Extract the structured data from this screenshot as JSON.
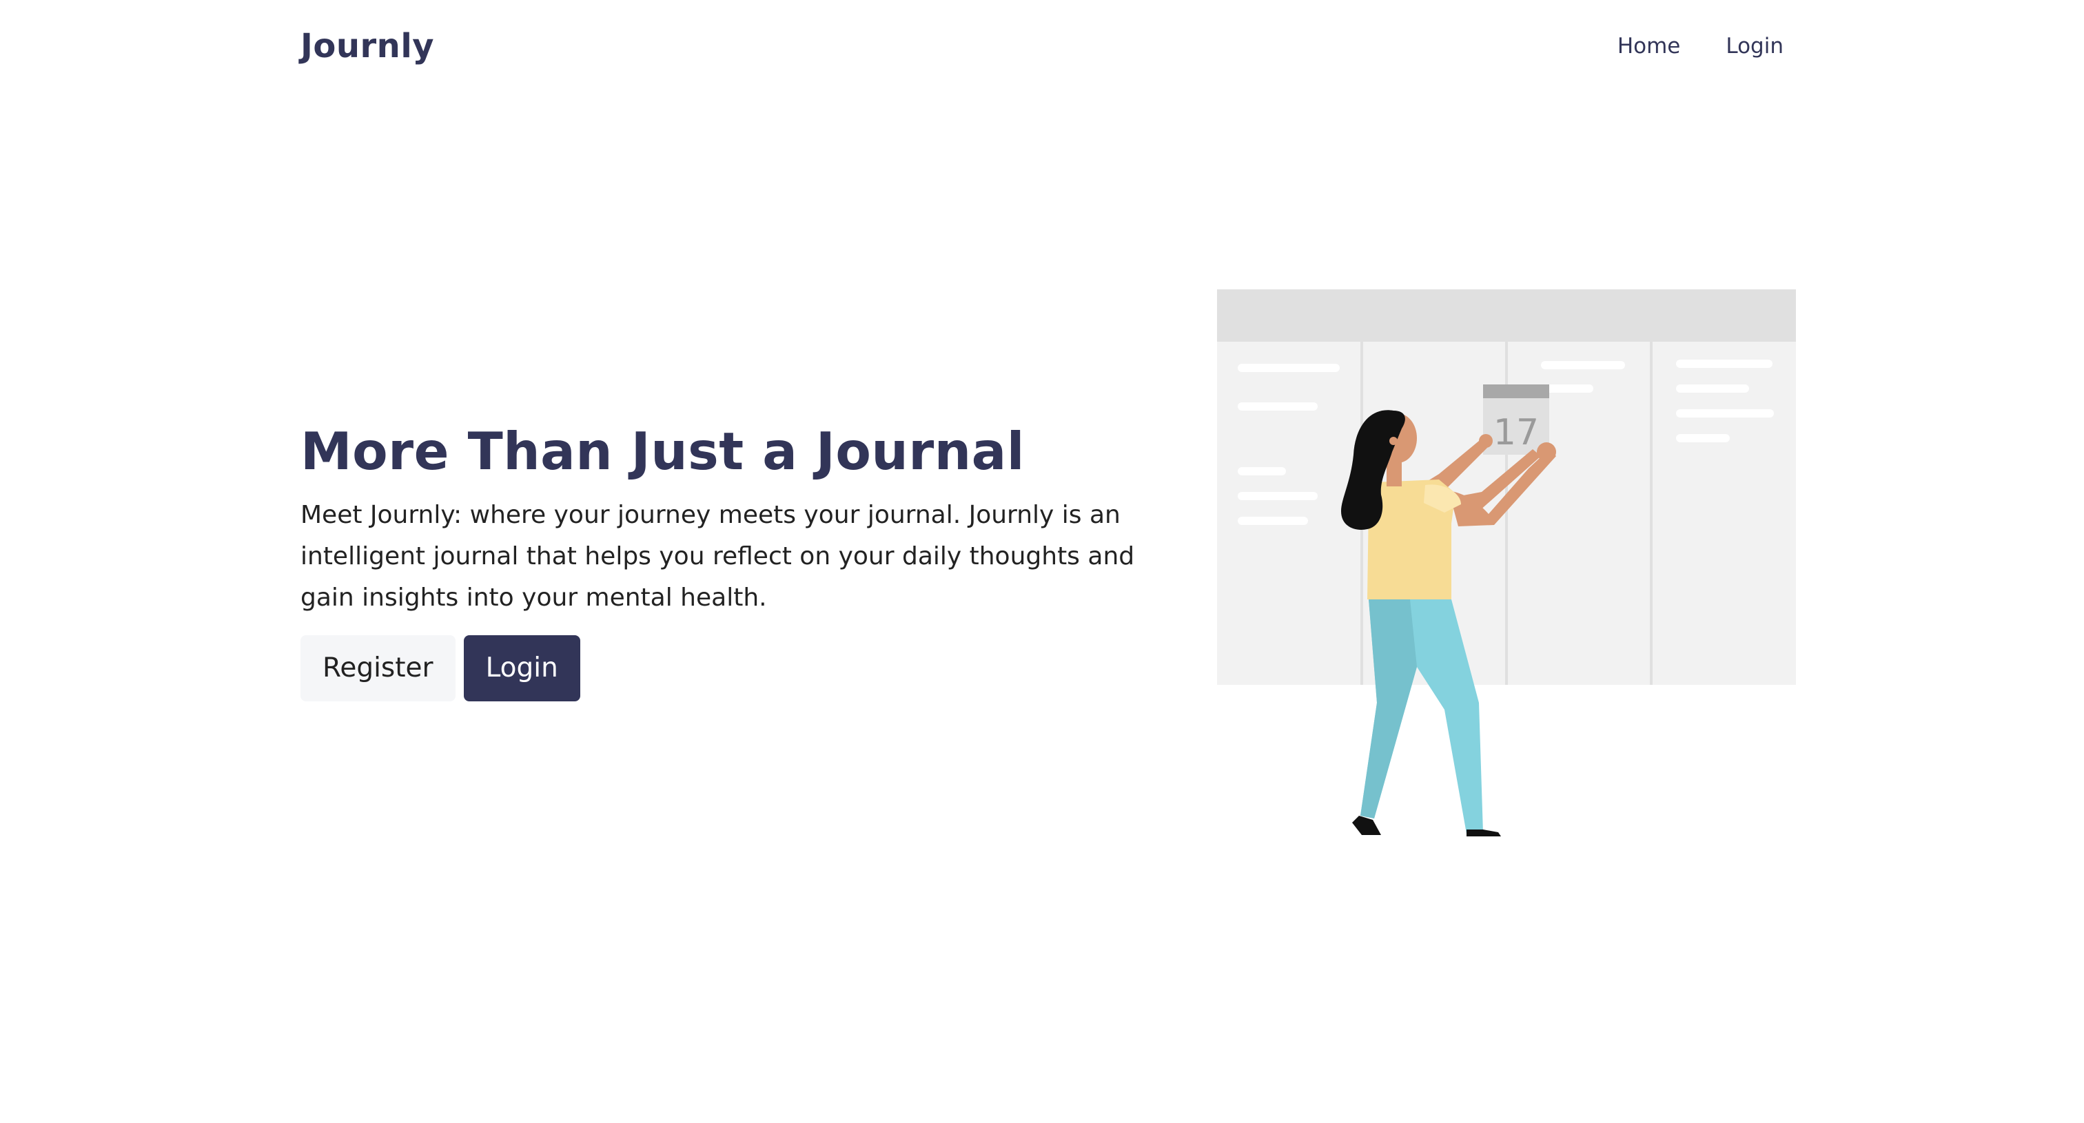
{
  "nav": {
    "brand": "Journly",
    "links": [
      "Home",
      "Login"
    ]
  },
  "hero": {
    "title": "More Than Just a Journal",
    "description": "Meet Journly: where your journey meets your journal. Journly is an intelligent journal that helps you reflect on your daily thoughts and gain insights into your mental health.",
    "register_label": "Register",
    "login_label": "Login"
  },
  "illustration": {
    "calendar_day": "17"
  },
  "colors": {
    "primary": "#323558",
    "secondary_button_bg": "#f5f6f8"
  }
}
